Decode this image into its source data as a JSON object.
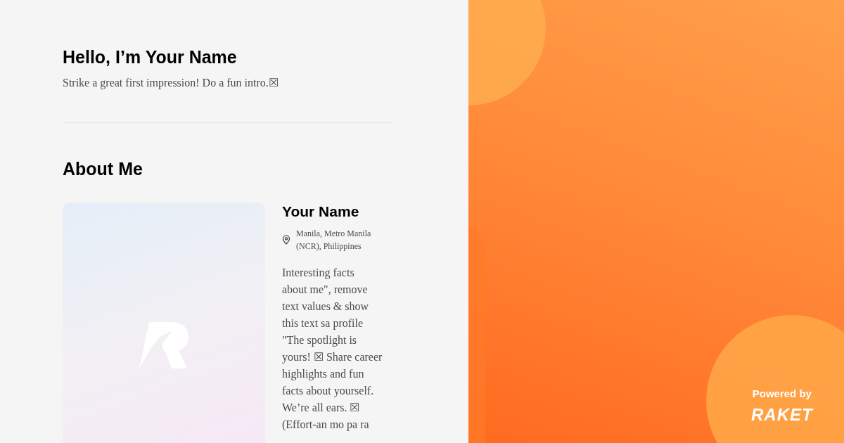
{
  "intro": {
    "heading": "Hello, I’m Your Name",
    "tagline": "Strike a great first impression! Do a fun intro.☒"
  },
  "about": {
    "heading": "About Me",
    "name": "Your Name",
    "location": [
      "Manila, Metro Manila",
      "(NCR), Philippines"
    ],
    "bio_lines": [
      "Interesting facts",
      "about me\", remove",
      "text values & show",
      "this text sa profile",
      "\"The spotlight is",
      "yours! ☒ Share career",
      "highlights and fun",
      "facts about yourself.",
      "We’re all ears. ☒",
      "(Effort-an mo pa ra"
    ]
  },
  "branding": {
    "powered_by": "Powered by",
    "logo": "RAKET"
  }
}
